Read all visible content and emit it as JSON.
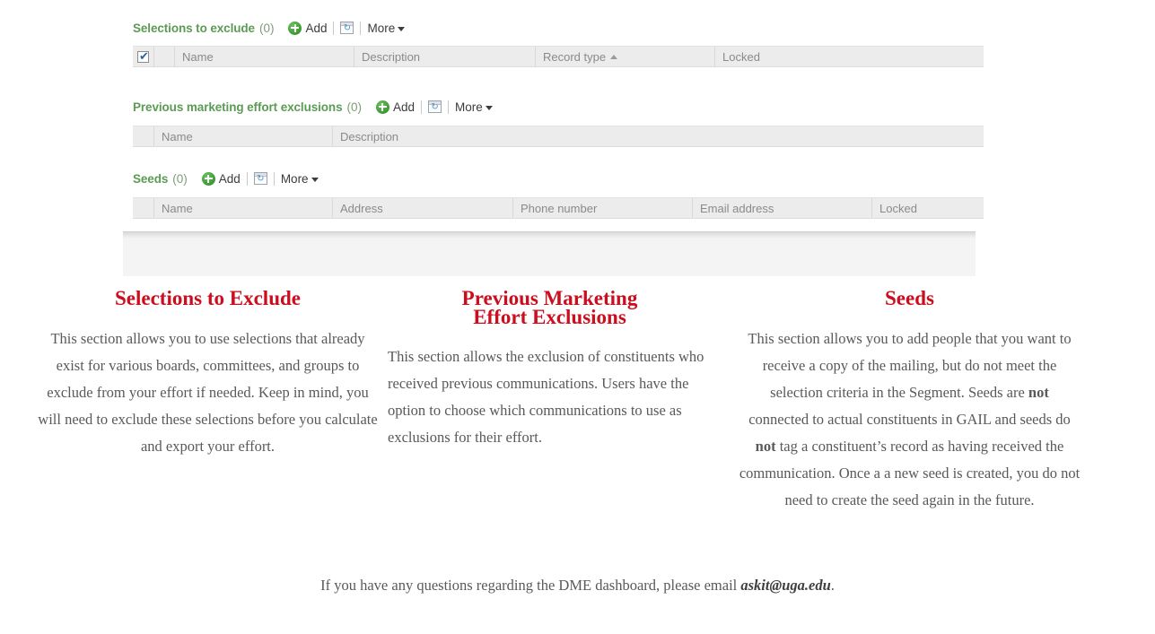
{
  "sections": [
    {
      "title": "Selections to exclude",
      "count": "(0)",
      "add_label": "Add",
      "more_label": "More",
      "refresh_glyph": "↻",
      "columns": [
        "",
        "",
        "Name",
        "Description",
        "Record type",
        "Locked"
      ],
      "sorted_column": "Record type",
      "sort_direction": "ascending",
      "select_all_checked": true,
      "check_glyph": "✔"
    },
    {
      "title": "Previous marketing effort exclusions",
      "count": "(0)",
      "add_label": "Add",
      "more_label": "More",
      "refresh_glyph": "↻",
      "columns": [
        "",
        "Name",
        "Description"
      ]
    },
    {
      "title": "Seeds",
      "count": "(0)",
      "add_label": "Add",
      "more_label": "More",
      "refresh_glyph": "↻",
      "columns": [
        "",
        "Name",
        "Address",
        "Phone number",
        "Email address",
        "Locked"
      ]
    }
  ],
  "info": {
    "selections_to_exclude": {
      "title": "Selections to Exclude",
      "body": "This section allows you to use selections that already exist for various boards, committees, and groups to exclude from your effort if needed. Keep in mind, you will need to exclude these selections before you calculate and export your effort."
    },
    "previous_marketing_effort_exclusions": {
      "title_line1": "Previous Marketing",
      "title_line2": "Effort Exclusions",
      "body": "This section allows the exclusion of constituents who received previous communications. Users have the option to choose which communications to use as exclusions for their effort."
    },
    "seeds": {
      "title": "Seeds",
      "body_part1": "This section allows you to add people that you want to receive a copy of the mailing, but do not meet the selection criteria in the Segment. Seeds are ",
      "bold1": "not",
      "body_part2": " connected to actual constituents in GAIL and seeds do ",
      "bold2": "not",
      "body_part3": " tag a constituent’s record as having received the communication. Once a a new seed is created, you do not need to create the seed again in the future."
    }
  },
  "footer": {
    "text_before": "If you have any questions regarding the DME dashboard, please email ",
    "email": "askit@uga.edu",
    "text_after": "."
  },
  "colors": {
    "section_title_green": "#5b9b54",
    "heading_red": "#cc0d1e",
    "body_gray": "#59595b",
    "grid_header_bg": "#ececec"
  }
}
